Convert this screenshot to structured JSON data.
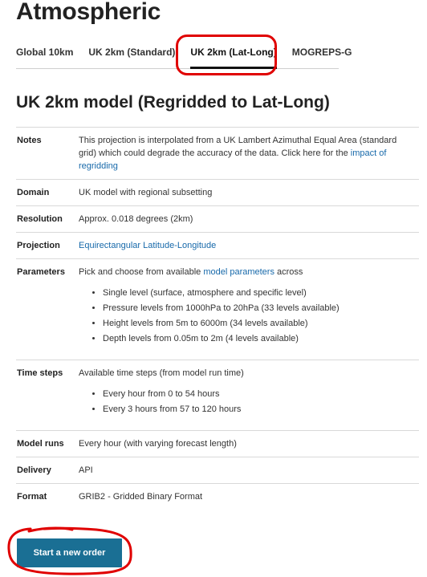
{
  "page": {
    "title": "Atmospheric",
    "subtitle": "UK 2km model (Regridded to Lat-Long)"
  },
  "tabs": [
    {
      "label": "Global 10km",
      "active": false
    },
    {
      "label": "UK 2km (Standard)",
      "active": false
    },
    {
      "label": "UK 2km (Lat-Long)",
      "active": true
    },
    {
      "label": "MOGREPS-G",
      "active": false
    }
  ],
  "spec": {
    "notes": {
      "label": "Notes",
      "text": "This projection is interpolated from a UK Lambert Azimuthal Equal Area (standard grid) which could degrade the accuracy of the data. Click here for the",
      "link": "impact of regridding"
    },
    "domain": {
      "label": "Domain",
      "value": "UK model with regional subsetting"
    },
    "resolution": {
      "label": "Resolution",
      "value": "Approx. 0.018 degrees (2km)"
    },
    "projection": {
      "label": "Projection",
      "link": "Equirectangular Latitude-Longitude"
    },
    "parameters": {
      "label": "Parameters",
      "intro_before": "Pick and choose from available",
      "intro_link": "model parameters",
      "intro_after": "across",
      "items": [
        "Single level (surface, atmosphere and specific level)",
        "Pressure levels from 1000hPa to 20hPa (33 levels available)",
        "Height levels from 5m to 6000m (34 levels available)",
        "Depth levels from 0.05m to 2m (4 levels available)"
      ]
    },
    "time_steps": {
      "label": "Time steps",
      "intro": "Available time steps (from model run time)",
      "items": [
        "Every hour from 0 to 54 hours",
        "Every 3 hours from 57 to 120 hours"
      ]
    },
    "model_runs": {
      "label": "Model runs",
      "value": "Every hour (with varying forecast length)"
    },
    "delivery": {
      "label": "Delivery",
      "value": "API"
    },
    "format": {
      "label": "Format",
      "value": "GRIB2 - Gridded Binary Format"
    }
  },
  "actions": {
    "start_order_label": "Start a new order"
  },
  "colors": {
    "accent_button": "#1a6f94",
    "link": "#1769aa",
    "annotation": "#e00000"
  }
}
